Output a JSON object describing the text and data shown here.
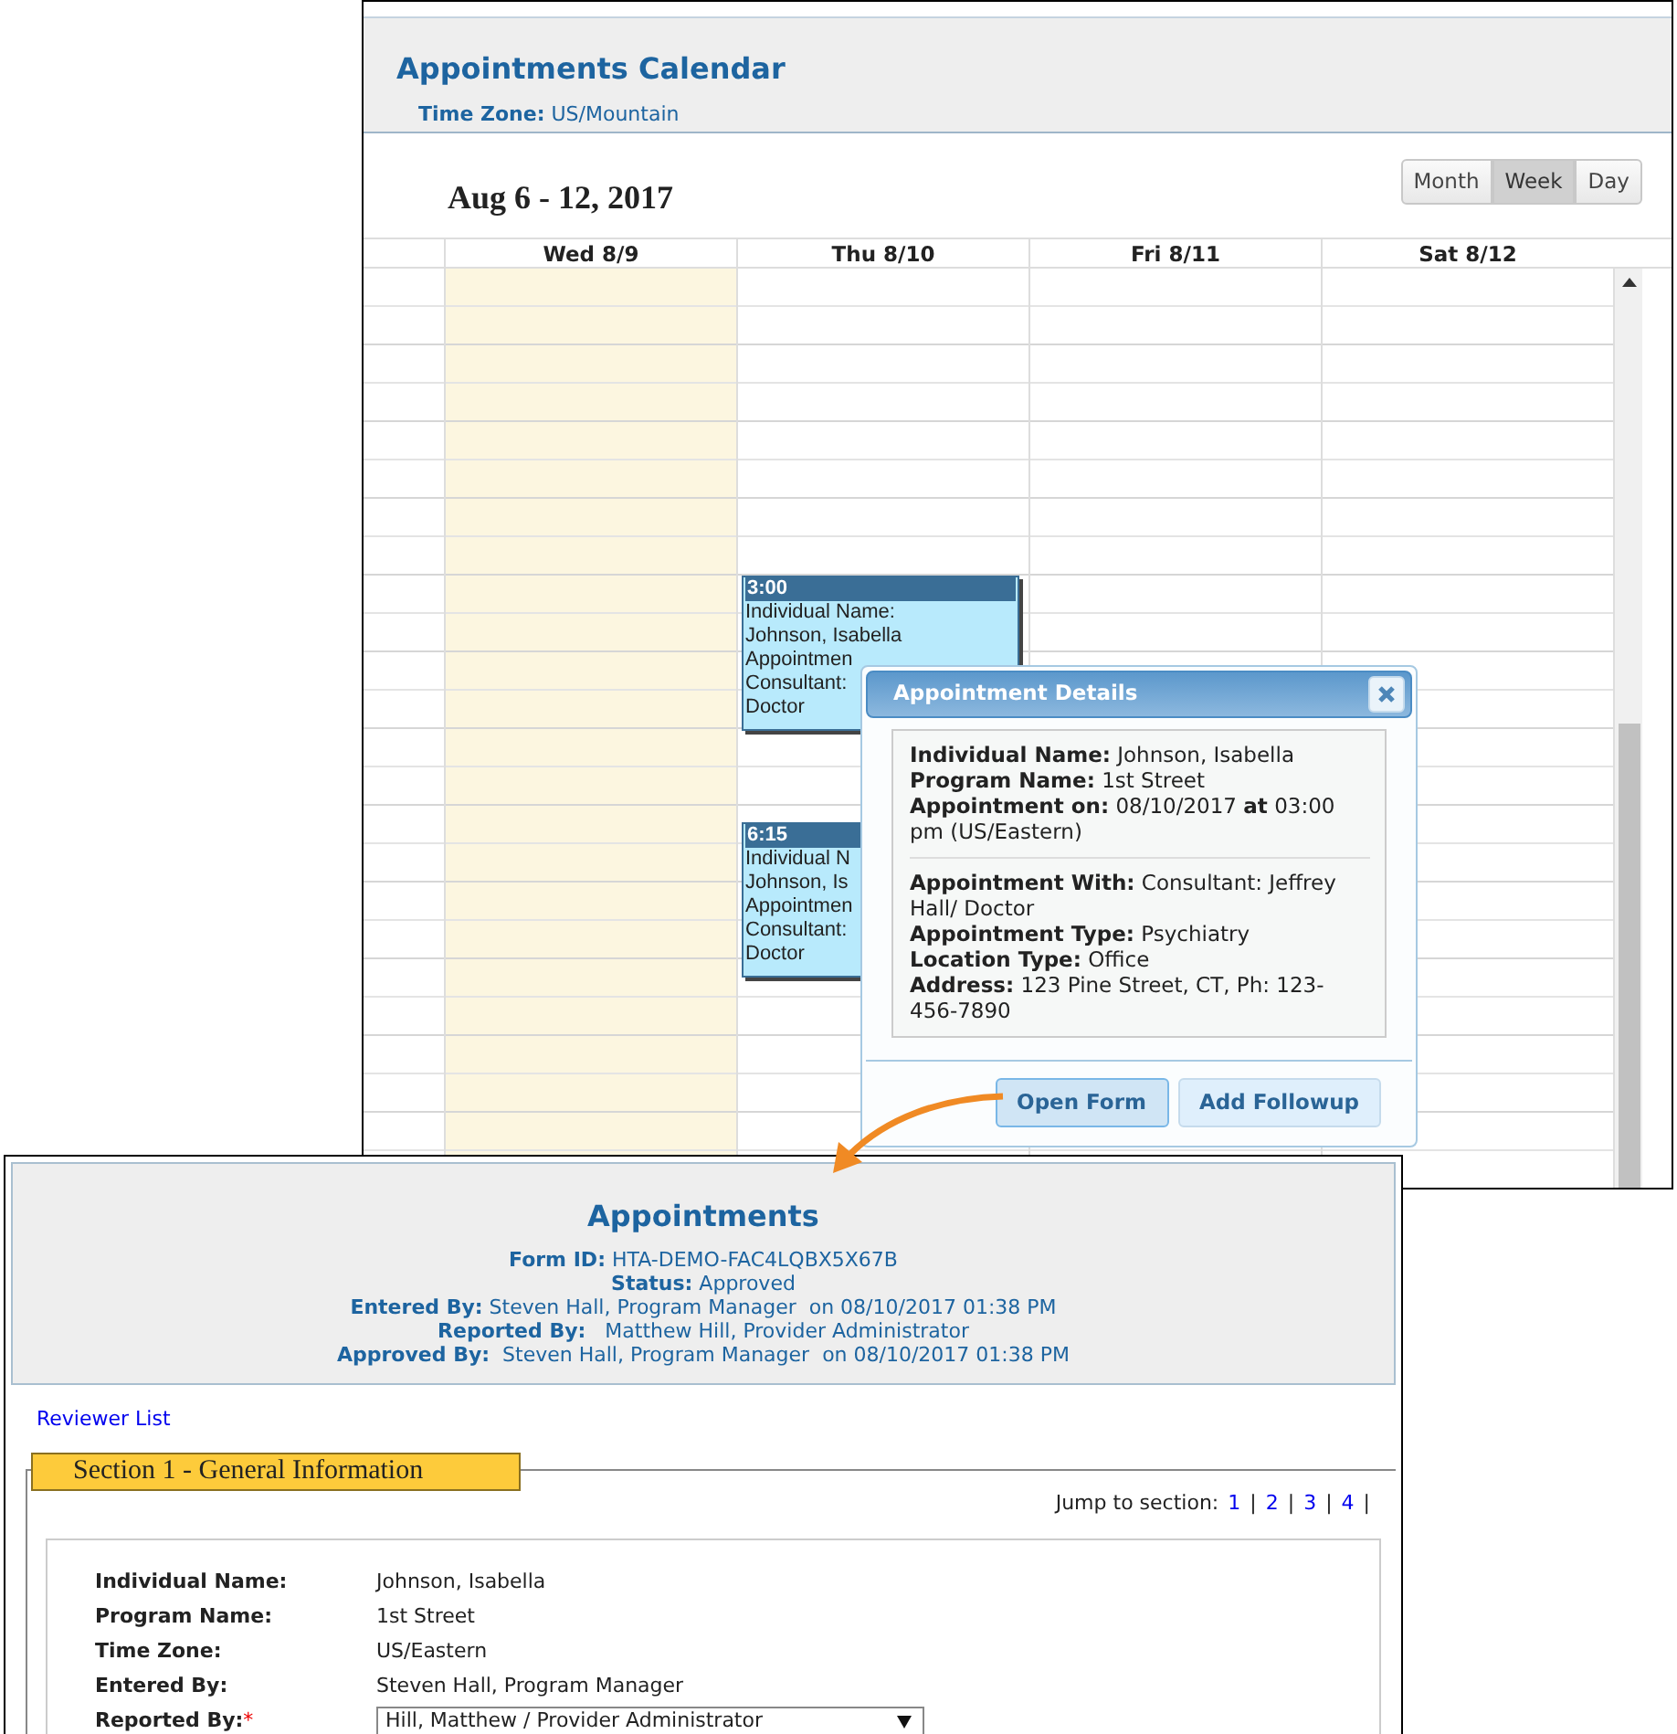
{
  "calendar": {
    "title": "Appointments Calendar",
    "time_zone_label": "Time Zone:",
    "time_zone": "US/Mountain",
    "range": "Aug 6 - 12, 2017",
    "views": [
      {
        "label": "Month",
        "selected": false
      },
      {
        "label": "Week",
        "selected": true
      },
      {
        "label": "Day",
        "selected": false
      }
    ],
    "columns": [
      {
        "label": "Wed 8/9",
        "today": true
      },
      {
        "label": "Thu 8/10",
        "today": false
      },
      {
        "label": "Fri 8/11",
        "today": false
      },
      {
        "label": "Sat 8/12",
        "today": false
      }
    ],
    "events": [
      {
        "time": "3:00",
        "lines": [
          "Individual Name:",
          "Johnson, Isabella",
          "Appointmen",
          "Consultant:",
          "Doctor"
        ]
      },
      {
        "time": "6:15",
        "lines": [
          "Individual N",
          "Johnson, Is",
          "Appointmen",
          "Consultant:",
          "Doctor"
        ]
      }
    ]
  },
  "dialog": {
    "title": "Appointment Details",
    "groups": [
      [
        "**Individual Name:** Johnson, Isabella",
        "**Program Name:** 1st Street",
        "**Appointment on:** 08/10/2017 **at** 03:00 pm (US/Eastern)"
      ],
      [
        "**Appointment With:** Consultant: Jeffrey Hall/ Doctor",
        "**Appointment Type:** Psychiatry",
        "**Location Type:** Office",
        "**Address:** 123 Pine Street, CT, Ph: 123-456-7890"
      ]
    ],
    "buttons": [
      {
        "label": "Open Form",
        "selected": true
      },
      {
        "label": "Add Followup",
        "selected": false
      }
    ]
  },
  "form": {
    "title": "Appointments",
    "meta": [
      "**Form ID:** HTA-DEMO-FAC4LQBX5X67B",
      "**Status:** Approved",
      "**Entered By:** Steven Hall, Program Manager  on 08/10/2017 01:38 PM",
      "**Reported By:**   Matthew Hill, Provider Administrator",
      "**Approved By:**  Steven Hall, Program Manager  on 08/10/2017 01:38 PM"
    ],
    "reviewer_link": "Reviewer List",
    "section": "Section 1 - General Information",
    "jump_label": "Jump to section:",
    "jump_links": [
      "1",
      "2",
      "3",
      "4"
    ],
    "jump_separator": "|",
    "fields": [
      {
        "label": "Individual Name:",
        "value": "Johnson, Isabella",
        "kind": "text"
      },
      {
        "label": "Program Name:",
        "value": "1st Street",
        "kind": "text"
      },
      {
        "label": "Time Zone:",
        "value": "US/Eastern",
        "kind": "text"
      },
      {
        "label": "Entered By:",
        "value": "Steven Hall, Program Manager",
        "kind": "text"
      },
      {
        "label": "Reported By:",
        "required_mark": "*",
        "value": "Hill, Matthew / Provider Administrator",
        "kind": "select"
      }
    ]
  }
}
